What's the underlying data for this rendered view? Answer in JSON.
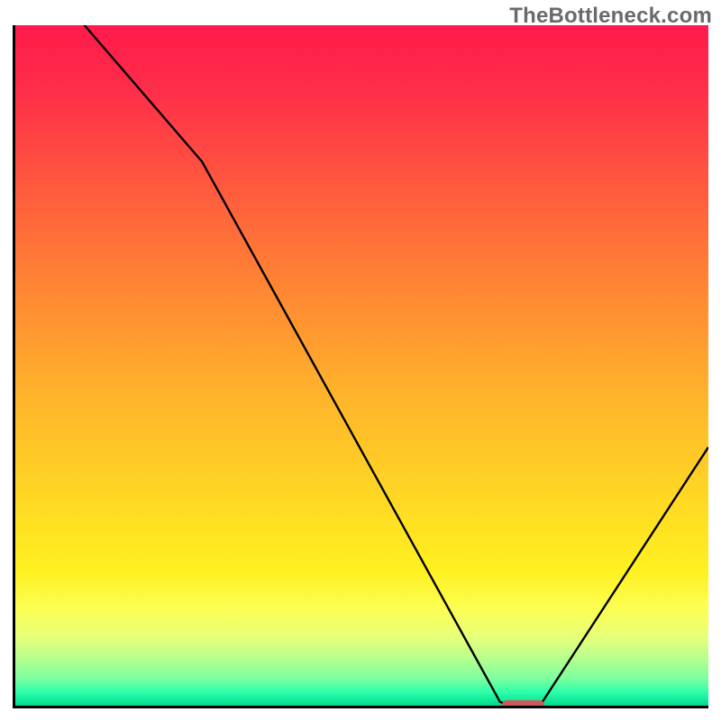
{
  "watermark": "TheBottleneck.com",
  "colors": {
    "gradient_top": "#ff1a4b",
    "gradient_mid": "#ffd924",
    "gradient_bottom": "#00d98c",
    "axis": "#000000",
    "curve": "#000000",
    "marker": "#cc5a5a"
  },
  "chart_data": {
    "type": "line",
    "title": "",
    "xlabel": "",
    "ylabel": "",
    "xlim": [
      0,
      100
    ],
    "ylim": [
      0,
      100
    ],
    "grid": false,
    "x": [
      0,
      10,
      27,
      70,
      76,
      100
    ],
    "values": [
      122,
      100,
      80,
      0,
      0,
      38
    ],
    "marker": {
      "x_start": 70,
      "x_end": 76,
      "y": 0
    },
    "notes": "Values above 100 are clipped at the top edge; y=0 sits on the x-axis. Positions read from pixel gridlines."
  }
}
